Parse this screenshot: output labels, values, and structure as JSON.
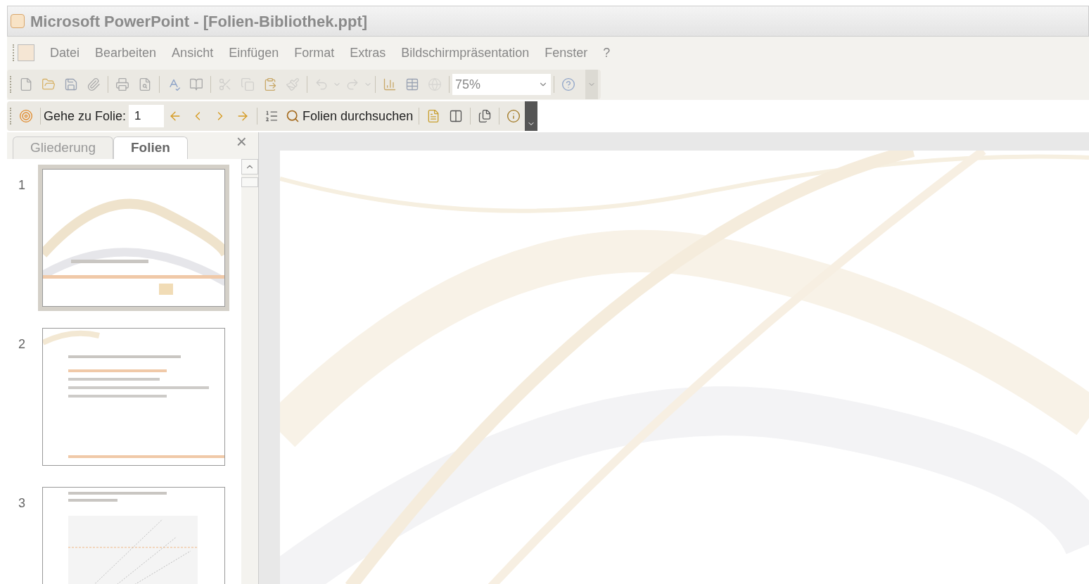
{
  "window": {
    "title": "Microsoft PowerPoint - [Folien-Bibliothek.ppt]"
  },
  "menu": {
    "items": [
      {
        "label": "Datei"
      },
      {
        "label": "Bearbeiten"
      },
      {
        "label": "Ansicht"
      },
      {
        "label": "Einfügen"
      },
      {
        "label": "Format"
      },
      {
        "label": "Extras"
      },
      {
        "label": "Bildschirmpräsentation"
      },
      {
        "label": "Fenster"
      },
      {
        "label": "?"
      }
    ]
  },
  "standard_toolbar": {
    "zoom": "75%"
  },
  "navigation_toolbar": {
    "goto_label": "Gehe zu Folie:",
    "goto_value": "1",
    "search_button": "Folien durchsuchen"
  },
  "panel": {
    "tabs": [
      {
        "label": "Gliederung",
        "selected": false
      },
      {
        "label": "Folien",
        "selected": true
      }
    ],
    "close": "×",
    "slides": [
      {
        "number": "1",
        "kind": "title",
        "selected": true
      },
      {
        "number": "2",
        "kind": "agenda",
        "selected": false
      },
      {
        "number": "3",
        "kind": "chart",
        "selected": false
      }
    ]
  }
}
